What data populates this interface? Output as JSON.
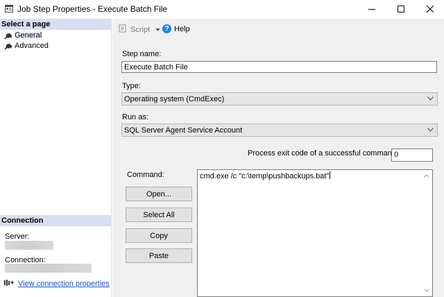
{
  "window": {
    "title": "Job Step Properties - Execute Batch File"
  },
  "left_panel": {
    "select_page_header": "Select a page",
    "pages": [
      {
        "label": "General",
        "icon": "wrench-icon",
        "selected": true
      },
      {
        "label": "Advanced",
        "icon": "wrench-icon",
        "selected": false
      }
    ],
    "connection_header": "Connection",
    "server_label": "Server:",
    "connection_label": "Connection:",
    "view_connection_link": "View connection properties"
  },
  "toolbar": {
    "script_label": "Script",
    "help_label": "Help"
  },
  "form": {
    "step_name_label": "Step name:",
    "step_name_value": "Execute Batch File",
    "type_label": "Type:",
    "type_value": "Operating system (CmdExec)",
    "run_as_label": "Run as:",
    "run_as_value": "SQL Server Agent Service Account",
    "exit_code_label": "Process exit code of a successful command:",
    "exit_code_value": "0",
    "command_label": "Command:",
    "command_value": "cmd.exe /c \"c:\\temp\\pushbackups.bat\"",
    "buttons": {
      "open": "Open...",
      "select_all": "Select All",
      "copy": "Copy",
      "paste": "Paste"
    }
  },
  "colors": {
    "section_header_bg": "#d5dff0",
    "link": "#1a4fd6",
    "panel_bg": "#f0f0f0"
  }
}
